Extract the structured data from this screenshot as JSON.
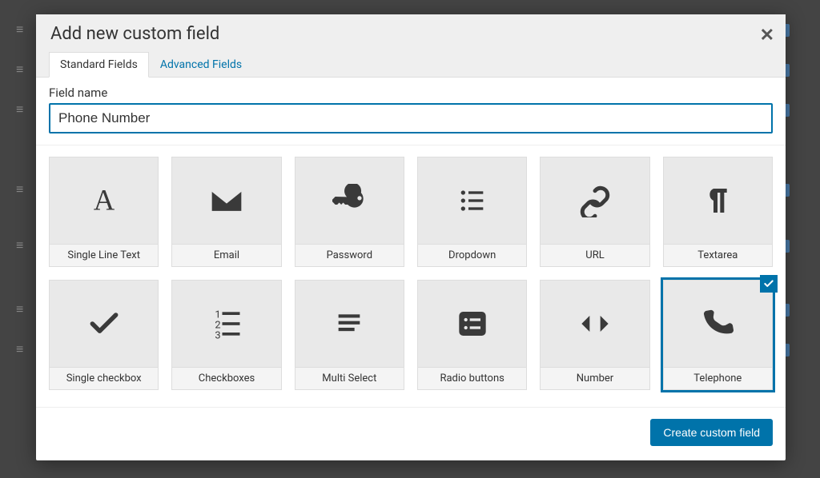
{
  "modal": {
    "title": "Add new custom field",
    "tabs": [
      {
        "label": "Standard Fields",
        "active": true
      },
      {
        "label": "Advanced Fields",
        "active": false
      }
    ],
    "fieldNameLabel": "Field name",
    "fieldNameValue": "Phone Number",
    "fieldTypes": [
      {
        "id": "single-line-text",
        "label": "Single Line Text",
        "icon": "text-a"
      },
      {
        "id": "email",
        "label": "Email",
        "icon": "envelope"
      },
      {
        "id": "password",
        "label": "Password",
        "icon": "key"
      },
      {
        "id": "dropdown",
        "label": "Dropdown",
        "icon": "list-bullets"
      },
      {
        "id": "url",
        "label": "URL",
        "icon": "link"
      },
      {
        "id": "textarea",
        "label": "Textarea",
        "icon": "pilcrow"
      },
      {
        "id": "single-checkbox",
        "label": "Single checkbox",
        "icon": "check"
      },
      {
        "id": "checkboxes",
        "label": "Checkboxes",
        "icon": "numbered-list"
      },
      {
        "id": "multi-select",
        "label": "Multi Select",
        "icon": "lines"
      },
      {
        "id": "radio-buttons",
        "label": "Radio buttons",
        "icon": "radio"
      },
      {
        "id": "number",
        "label": "Number",
        "icon": "arrows"
      },
      {
        "id": "telephone",
        "label": "Telephone",
        "icon": "phone",
        "selected": true
      }
    ],
    "createButton": "Create custom field"
  }
}
